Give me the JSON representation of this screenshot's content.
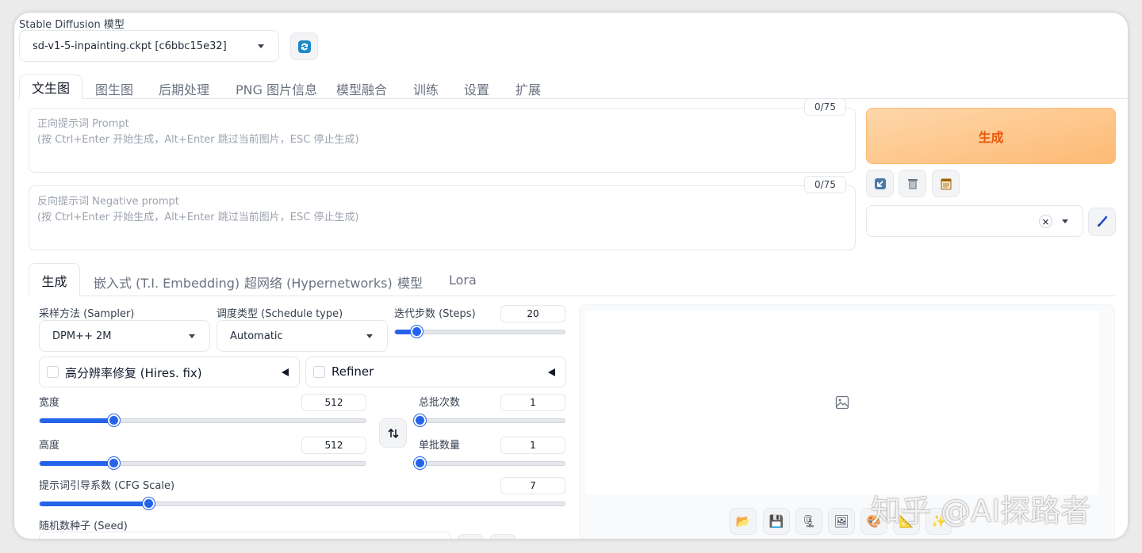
{
  "model": {
    "label": "Stable Diffusion 模型",
    "selected": "sd-v1-5-inpainting.ckpt [c6bbc15e32]"
  },
  "main_tabs": [
    {
      "label": "文生图"
    },
    {
      "label": "图生图"
    },
    {
      "label": "后期处理"
    },
    {
      "label": "PNG 图片信息"
    },
    {
      "label": "模型融合"
    },
    {
      "label": "训练"
    },
    {
      "label": "设置"
    },
    {
      "label": "扩展"
    }
  ],
  "prompt": {
    "counter": "0/75",
    "placeholder_line1": "正向提示词 Prompt",
    "placeholder_line2": "(按 Ctrl+Enter 开始生成，Alt+Enter 跳过当前图片，ESC 停止生成)"
  },
  "negative_prompt": {
    "counter": "0/75",
    "placeholder_line1": "反向提示词 Negative prompt",
    "placeholder_line2": "(按 Ctrl+Enter 开始生成，Alt+Enter 跳过当前图片，ESC 停止生成)"
  },
  "generate_button": "生成",
  "style_dropdown": {
    "clear": "×"
  },
  "sub_tabs": [
    {
      "label": "生成"
    },
    {
      "label": "嵌入式 (T.I. Embedding)"
    },
    {
      "label": "超网络 (Hypernetworks)"
    },
    {
      "label": "模型"
    },
    {
      "label": "Lora"
    }
  ],
  "sampler": {
    "label": "采样方法 (Sampler)",
    "value": "DPM++ 2M"
  },
  "schedule": {
    "label": "调度类型 (Schedule type)",
    "value": "Automatic"
  },
  "steps": {
    "label": "迭代步数 (Steps)",
    "value": "20",
    "min": 1,
    "max": 150
  },
  "hires_fix": {
    "label": "高分辨率修复 (Hires. fix)",
    "checked": false
  },
  "refiner": {
    "label": "Refiner",
    "checked": false
  },
  "width": {
    "label": "宽度",
    "value": "512",
    "min": 64,
    "max": 2048
  },
  "height": {
    "label": "高度",
    "value": "512",
    "min": 64,
    "max": 2048
  },
  "batch_count": {
    "label": "总批次数",
    "value": "1",
    "min": 1,
    "max": 100
  },
  "batch_size": {
    "label": "单批数量",
    "value": "1",
    "min": 1,
    "max": 8
  },
  "cfg_scale": {
    "label": "提示词引导系数 (CFG Scale)",
    "value": "7",
    "min": 1,
    "max": 30
  },
  "seed": {
    "label": "随机数种子 (Seed)"
  },
  "watermark": "知乎 @AI探路者",
  "output_tools": [
    {
      "icon": "folder-icon",
      "glyph": "📂"
    },
    {
      "icon": "save-icon",
      "glyph": "💾"
    },
    {
      "icon": "zip-icon",
      "glyph": "🗜"
    },
    {
      "icon": "send-to-img2img-icon",
      "glyph": "🖼"
    },
    {
      "icon": "send-to-inpaint-icon",
      "glyph": "🎨"
    },
    {
      "icon": "send-to-extras-icon",
      "glyph": "📐"
    },
    {
      "icon": "sparkle-icon",
      "glyph": "✨"
    }
  ],
  "colors": {
    "accent": "#2563eb",
    "generate_from": "#fed7aa",
    "generate_to": "#fdba74",
    "generate_text": "#ea580c"
  }
}
